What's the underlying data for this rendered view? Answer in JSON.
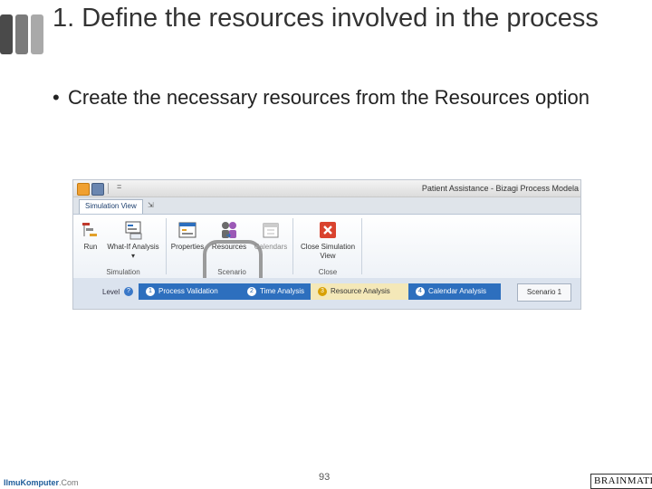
{
  "slide": {
    "title": "1. Define the resources involved in the process",
    "bullet_marker": "•",
    "bullet": "Create the necessary resources from the Resources option",
    "page_number": "93"
  },
  "app": {
    "window_title": "Patient Assistance - Bizagi Process Modela",
    "quick_access_more": "=",
    "tabs": {
      "active": "Simulation View",
      "extra": "⇲"
    },
    "ribbon": {
      "run": "Run",
      "what_if": "What-If Analysis",
      "what_if_arrow": "▾",
      "properties": "Properties",
      "resources": "Resources",
      "calendars": "Calendars",
      "close_view": "Close Simulation View",
      "groups": {
        "simulation": "Simulation",
        "scenario": "Scenario",
        "close": "Close"
      }
    },
    "level_bar": {
      "label": "Level",
      "help": "?",
      "steps": [
        {
          "num": "1",
          "label": "Process Validation"
        },
        {
          "num": "2",
          "label": "Time Analysis"
        },
        {
          "num": "3",
          "label": "Resource Analysis"
        },
        {
          "num": "4",
          "label": "Calendar Analysis"
        }
      ],
      "scenario": "Scenario 1"
    }
  },
  "footer": {
    "left_brand": "IlmuKomputer",
    "left_suffix": ".Com",
    "right_logo": "BRAINMATICS"
  },
  "colors": {
    "accent_blue": "#2d6fbe",
    "active_step": "#f4e8b8",
    "highlight_circle": "#8b8b8b"
  }
}
